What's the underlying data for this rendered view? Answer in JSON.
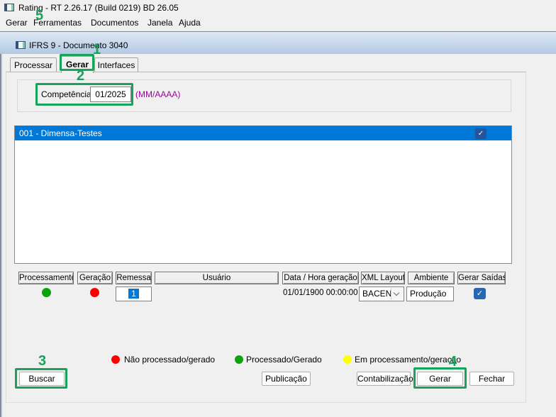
{
  "app": {
    "title": "Rating - RT 2.26.17 (Build 0219) BD 26.05",
    "menu": {
      "items": [
        "Gerar",
        "Ferramentas",
        "Documentos",
        "Janela",
        "Ajuda"
      ]
    }
  },
  "child_window": {
    "title": "IFRS 9 - Documento 3040",
    "tabs": [
      "Processar",
      "Gerar",
      "Interfaces"
    ],
    "selected_tab": "Gerar"
  },
  "competencia": {
    "label": "Competência",
    "value": "01/2025",
    "format_hint": "(MM/AAAA)"
  },
  "document_list": {
    "items": [
      {
        "label": "001 - Dimensa-Testes",
        "selected": true,
        "checked": true
      }
    ]
  },
  "grid": {
    "headers": [
      "Processamento",
      "Geração",
      "Remessa",
      "Usuário",
      "Data / Hora geração",
      "XML Layout",
      "Ambiente",
      "Gerar Saídas"
    ],
    "row": {
      "processamento_status": "processado",
      "geracao_status": "nao_processado",
      "remessa": "1",
      "usuario": "",
      "data_hora_geracao": "01/01/1900 00:00:00",
      "xml_layout": "BACEN",
      "ambiente": "Produção",
      "gerar_saidas_checked": true
    }
  },
  "legend": {
    "items": [
      {
        "label": "Não processado/gerado",
        "color": "#ff0000"
      },
      {
        "label": "Processado/Gerado",
        "color": "#0ca30c"
      },
      {
        "label": "Em processamento/geração",
        "color": "#ffff00"
      }
    ]
  },
  "buttons": {
    "buscar": "Buscar",
    "publicacao": "Publicação",
    "contabilizacao": "Contabilização",
    "gerar": "Gerar",
    "fechar": "Fechar"
  },
  "annotations": {
    "color": "#17a35b",
    "steps": [
      "1",
      "2",
      "3",
      "4",
      "5"
    ]
  },
  "icons": {
    "check": "✓"
  },
  "colors": {
    "selection_blue": "#0078d7",
    "status_green": "#0ca30c",
    "status_red": "#ff0000",
    "status_yellow": "#ffff00",
    "hint_magenta": "#9b009b",
    "child_titlebar_top": "#dde8f4",
    "child_titlebar_bottom": "#b2c8e2"
  }
}
